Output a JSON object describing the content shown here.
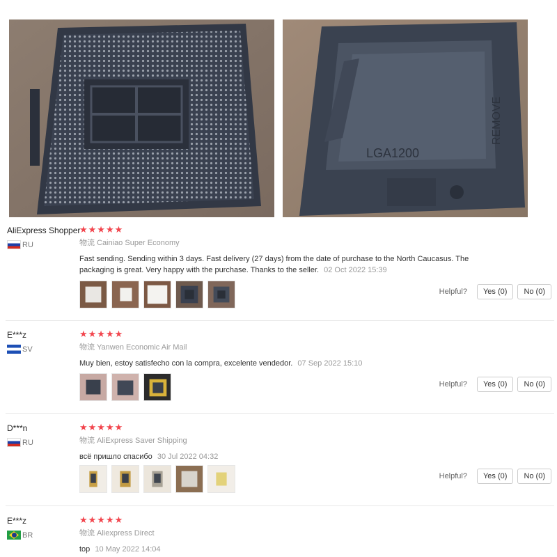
{
  "hero": {
    "left_photo_icon": "socket-pins-photo",
    "right_photo_icon": "socket-cover-photo",
    "cover_marking": "LGA1200",
    "cover_side_text": "REMOVE"
  },
  "helpful_label": "Helpful?",
  "yes_label": "Yes (0)",
  "no_label": "No (0)",
  "star_color": "#f2454d",
  "reviews": [
    {
      "name": "AliExpress Shopper",
      "country": "RU",
      "stars": "★★★★★",
      "shipping_label": "物流",
      "shipping": "Cainiao Super Economy",
      "text": "Fast sending. Sending within 3 days. Fast delivery (27 days) from the date of purchase to the North Caucasus. The packaging is great. Very happy with the purchase. Thanks to the seller.",
      "date": "02 Oct 2022 15:39"
    },
    {
      "name": "E***z",
      "country": "SV",
      "stars": "★★★★★",
      "shipping_label": "物流",
      "shipping": "Yanwen Economic Air Mail",
      "text": "Muy bien, estoy satisfecho con la compra, excelente vendedor.",
      "date": "07 Sep 2022 15:10"
    },
    {
      "name": "D***n",
      "country": "RU",
      "stars": "★★★★★",
      "shipping_label": "物流",
      "shipping": "AliExpress Saver Shipping",
      "text": "всё пришло спасибо",
      "date": "30 Jul 2022 04:32"
    },
    {
      "name": "E***z",
      "country": "BR",
      "stars": "★★★★★",
      "shipping_label": "物流",
      "shipping": "Aliexpress Direct",
      "text": "top",
      "date": "10 May 2022 14:04"
    }
  ]
}
